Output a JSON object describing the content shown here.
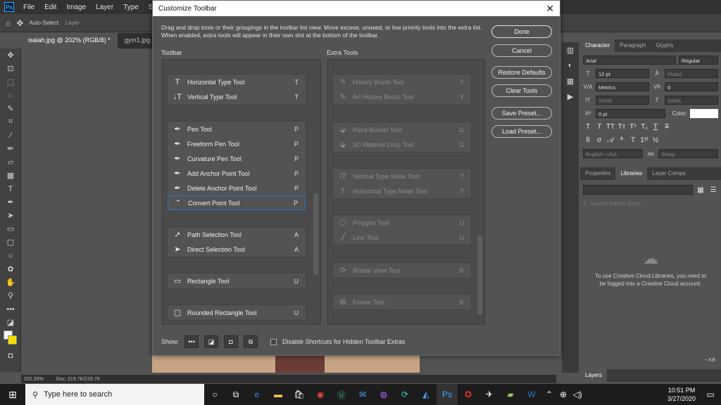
{
  "app": {
    "menus": [
      "File",
      "Edit",
      "Image",
      "Layer",
      "Type",
      "Select"
    ],
    "logo": "Ps",
    "options": {
      "auto_select": "Auto-Select:",
      "layer": "Layer"
    },
    "tabs": [
      "isaiah.jpg @ 202% (RGB/8) *",
      "gym1.jpg"
    ],
    "status": {
      "zoom": "202.33%",
      "doc": "Doc: 219.7K/219.7K"
    }
  },
  "dialog": {
    "title": "Customize Toolbar",
    "description": "Drag and drop tools or their groupings in the toolbar list view. Move excess, unused, or low priority tools into the extra list. When enabled, extra tools will appear in their own slot at the bottom of the toolbar.",
    "toolbar_heading": "Toolbar",
    "extra_heading": "Extra Tools",
    "toolbar_groups": [
      [
        {
          "name": "Horizontal Type Tool",
          "key": "T"
        },
        {
          "name": "Vertical Type Tool",
          "key": "T"
        }
      ],
      [
        {
          "name": "Pen Tool",
          "key": "P"
        },
        {
          "name": "Freeform Pen Tool",
          "key": "P"
        },
        {
          "name": "Curvature Pen Tool",
          "key": "P"
        },
        {
          "name": "Add Anchor Point Tool",
          "key": "P"
        },
        {
          "name": "Delete Anchor Point Tool",
          "key": "P"
        },
        {
          "name": "Convert Point Tool",
          "key": "P"
        }
      ],
      [
        {
          "name": "Path Selection Tool",
          "key": "A"
        },
        {
          "name": "Direct Selection Tool",
          "key": "A"
        }
      ],
      [
        {
          "name": "Rectangle Tool",
          "key": "U"
        }
      ],
      [
        {
          "name": "Rounded Rectangle Tool",
          "key": "U"
        }
      ]
    ],
    "extra_groups": [
      [
        {
          "name": "History Brush Tool",
          "key": "Y"
        },
        {
          "name": "Art History Brush Tool",
          "key": "Y"
        }
      ],
      [
        {
          "name": "Paint Bucket Tool",
          "key": "G"
        },
        {
          "name": "3D Material Drop Tool",
          "key": "G"
        }
      ],
      [
        {
          "name": "Vertical Type Mask Tool",
          "key": "T"
        },
        {
          "name": "Horizontal Type Mask Tool",
          "key": "T"
        }
      ],
      [
        {
          "name": "Polygon Tool",
          "key": "U"
        },
        {
          "name": "Line Tool",
          "key": "U"
        }
      ],
      [
        {
          "name": "Rotate View Tool",
          "key": "R"
        }
      ],
      [
        {
          "name": "Frame Tool",
          "key": "K"
        }
      ]
    ],
    "buttons": {
      "done": "Done",
      "cancel": "Cancel",
      "restore": "Restore Defaults",
      "clear": "Clear Tools",
      "save": "Save Preset...",
      "load": "Load Preset..."
    },
    "show_label": "Show:",
    "disable_shortcuts": "Disable Shortcuts for Hidden Toolbar Extras"
  },
  "panels": {
    "char_tabs": [
      "Character",
      "Paragraph",
      "Glyphs"
    ],
    "font": "Arial",
    "style": "Regular",
    "size": "12 pt",
    "leading": "(Auto)",
    "kerning": "Metrics",
    "tracking": "0",
    "vscale": "100%",
    "hscale": "100%",
    "baseline": "0 pt",
    "color_label": "Color:",
    "language": "English: USA",
    "aa": "Sharp",
    "lib_tabs": [
      "Properties",
      "Libraries",
      "Layer Comps"
    ],
    "lib_search": "Search Adobe Stock",
    "lib_message": "To use Creative Cloud Libraries, you need to be logged into a Creative Cloud account.",
    "lib_size": "-- KB",
    "layers_tab": "Layers"
  },
  "taskbar": {
    "search_placeholder": "Type here to search",
    "time": "10:51 PM",
    "date": "3/27/2020"
  }
}
